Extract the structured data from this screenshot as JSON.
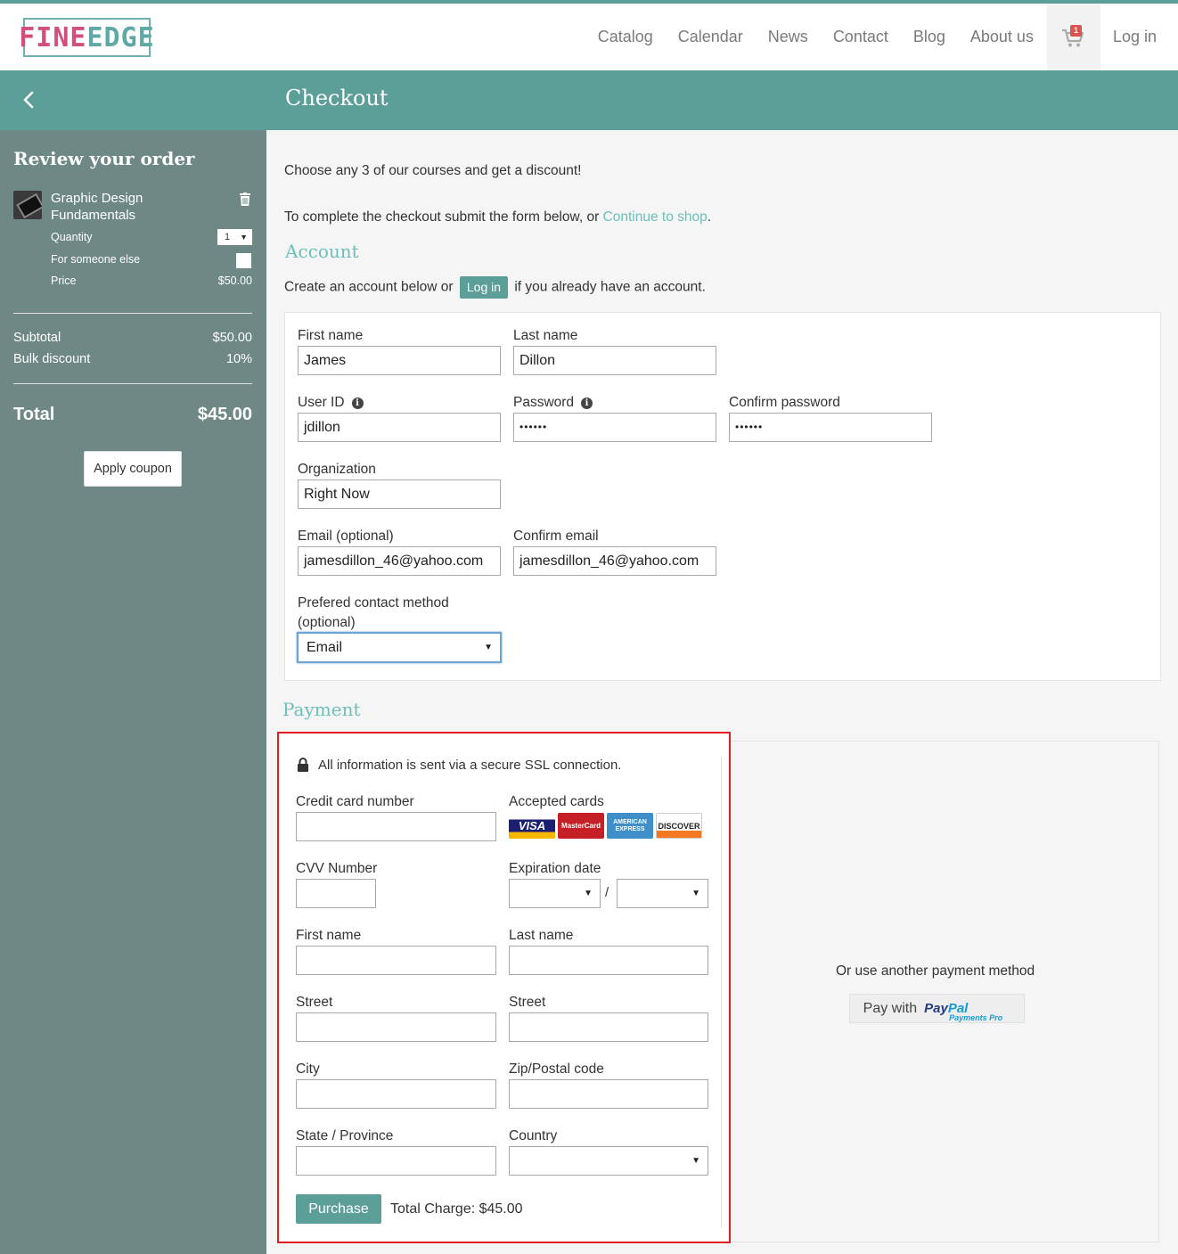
{
  "header": {
    "logo_part1": "FINE",
    "logo_part2": "EDGE",
    "nav": [
      "Catalog",
      "Calendar",
      "News",
      "Contact",
      "Blog",
      "About us"
    ],
    "cart_count": "1",
    "login_label": "Log in"
  },
  "titlebar": {
    "title": "Checkout"
  },
  "sidebar": {
    "heading": "Review your order",
    "product_name": "Graphic Design Fundamentals",
    "quantity_label": "Quantity",
    "quantity_value": "1",
    "someone_else_label": "For someone else",
    "price_label": "Price",
    "price_value": "$50.00",
    "subtotal_label": "Subtotal",
    "subtotal_value": "$50.00",
    "discount_label": "Bulk discount",
    "discount_value": "10%",
    "total_label": "Total",
    "total_value": "$45.00",
    "coupon_label": "Apply coupon"
  },
  "main": {
    "promo": "Choose any 3 of our courses and get a discount!",
    "complete_text": "To complete the checkout submit the form below, or ",
    "continue_link": "Continue to shop",
    "period": ".",
    "account_heading": "Account",
    "account_text_before": "Create an account below or",
    "account_login_btn": "Log in",
    "account_text_after": "if you already have an account."
  },
  "account": {
    "first_name_label": "First name",
    "first_name_value": "James",
    "last_name_label": "Last name",
    "last_name_value": "Dillon",
    "userid_label": "User ID",
    "userid_value": "jdillon",
    "password_label": "Password",
    "password_value": "••••••",
    "confirm_password_label": "Confirm password",
    "confirm_password_value": "••••••",
    "org_label": "Organization",
    "org_value": "Right Now",
    "email_label": "Email (optional)",
    "email_value": "jamesdillon_46@yahoo.com",
    "confirm_email_label": "Confirm email",
    "confirm_email_value": "jamesdillon_46@yahoo.com",
    "contact_label_1": "Prefered contact method",
    "contact_label_2": "(optional)",
    "contact_value": "Email"
  },
  "payment": {
    "heading": "Payment",
    "ssl_text": "All information is sent via a secure SSL connection.",
    "cc_label": "Credit card number",
    "accepted_label": "Accepted cards",
    "cards": [
      "VISA",
      "MasterCard",
      "AMERICAN EXPRESS",
      "DISCOVER"
    ],
    "cvv_label": "CVV Number",
    "exp_label": "Expiration date",
    "exp_sep": "/",
    "first_name_label": "First name",
    "last_name_label": "Last name",
    "street1_label": "Street",
    "street2_label": "Street",
    "city_label": "City",
    "zip_label": "Zip/Postal code",
    "state_label": "State / Province",
    "country_label": "Country",
    "purchase_label": "Purchase",
    "total_charge": "Total Charge: $45.00",
    "alt_text": "Or use another payment method",
    "paypal_prefix": "Pay with",
    "paypal_pay": "Pay",
    "paypal_pal": "Pal",
    "paypal_sub": "Payments Pro"
  }
}
